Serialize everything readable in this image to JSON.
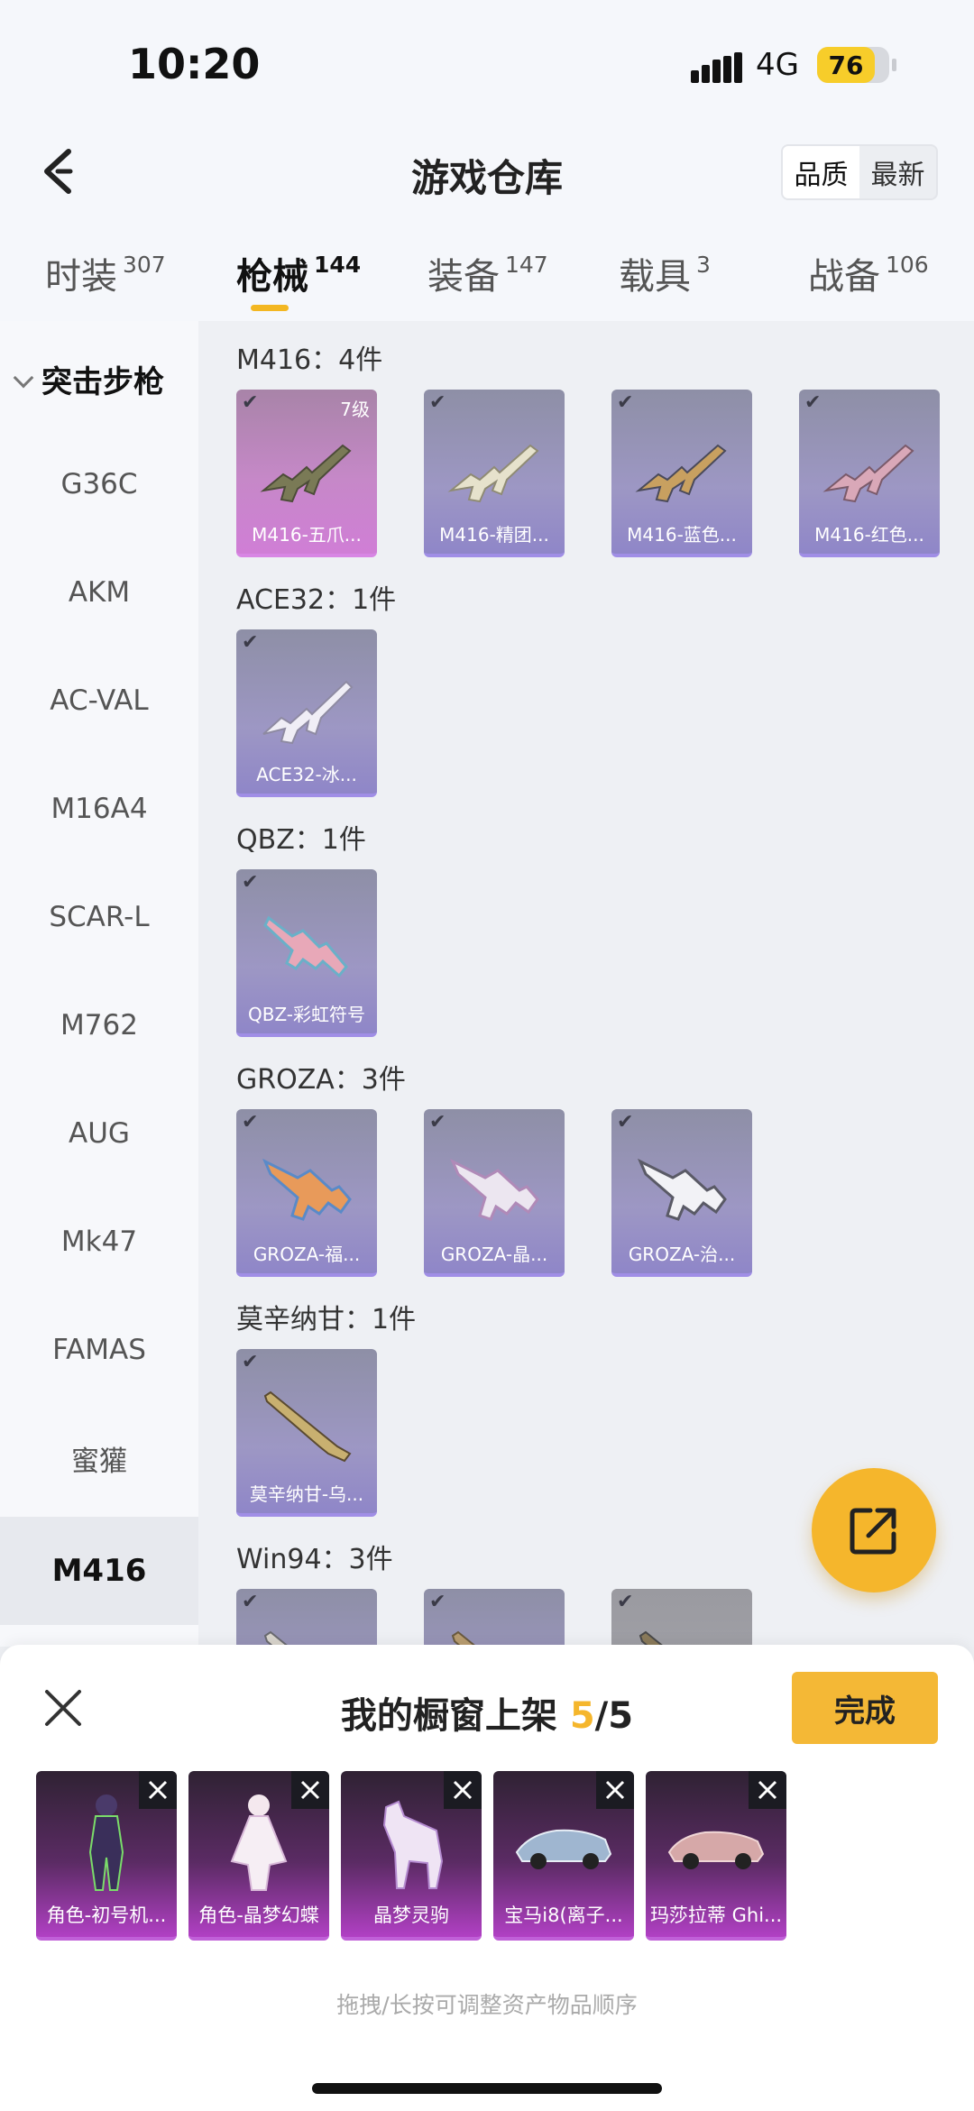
{
  "status": {
    "time": "10:20",
    "network": "4G",
    "battery": "76"
  },
  "header": {
    "title": "游戏仓库",
    "sort_options": [
      "品质",
      "最新"
    ],
    "sort_selected": "品质"
  },
  "tabs": [
    {
      "label": "时装",
      "count": "307"
    },
    {
      "label": "枪械",
      "count": "144",
      "active": true
    },
    {
      "label": "装备",
      "count": "147"
    },
    {
      "label": "载具",
      "count": "3"
    },
    {
      "label": "战备",
      "count": "106"
    }
  ],
  "sidebar": {
    "category": "突击步枪",
    "items": [
      "G36C",
      "AKM",
      "AC-VAL",
      "M16A4",
      "SCAR-L",
      "M762",
      "AUG",
      "Mk47",
      "FAMAS",
      "蜜獾",
      "M416"
    ],
    "selected": "M416"
  },
  "groups": [
    {
      "title": "M416：4件",
      "items": [
        {
          "name": "M416-五爪...",
          "level": "7级"
        },
        {
          "name": "M416-精团..."
        },
        {
          "name": "M416-蓝色..."
        },
        {
          "name": "M416-红色..."
        }
      ]
    },
    {
      "title": "ACE32：1件",
      "items": [
        {
          "name": "ACE32-冰..."
        }
      ]
    },
    {
      "title": "QBZ：1件",
      "items": [
        {
          "name": "QBZ-彩虹符号"
        }
      ]
    },
    {
      "title": "GROZA：3件",
      "items": [
        {
          "name": "GROZA-福..."
        },
        {
          "name": "GROZA-晶..."
        },
        {
          "name": "GROZA-治..."
        }
      ]
    },
    {
      "title": "莫辛纳甘：1件",
      "items": [
        {
          "name": "莫辛纳甘-乌..."
        }
      ]
    },
    {
      "title": "Win94：3件",
      "items": [
        {
          "name": ""
        },
        {
          "name": ""
        },
        {
          "name": ""
        }
      ]
    }
  ],
  "shelf": {
    "title": "我的橱窗上架",
    "count": "5",
    "total": "/5",
    "done_label": "完成",
    "items": [
      "角色-初号机...",
      "角色-晶梦幻蝶",
      "晶梦灵驹",
      "宝马i8(离子...",
      "玛莎拉蒂 Ghi..."
    ],
    "hint": "拖拽/长按可调整资产物品顺序"
  },
  "colors": {
    "accent": "#f5b62c",
    "card_purple": "#9d97c4",
    "card_pink": "#c688c8"
  }
}
